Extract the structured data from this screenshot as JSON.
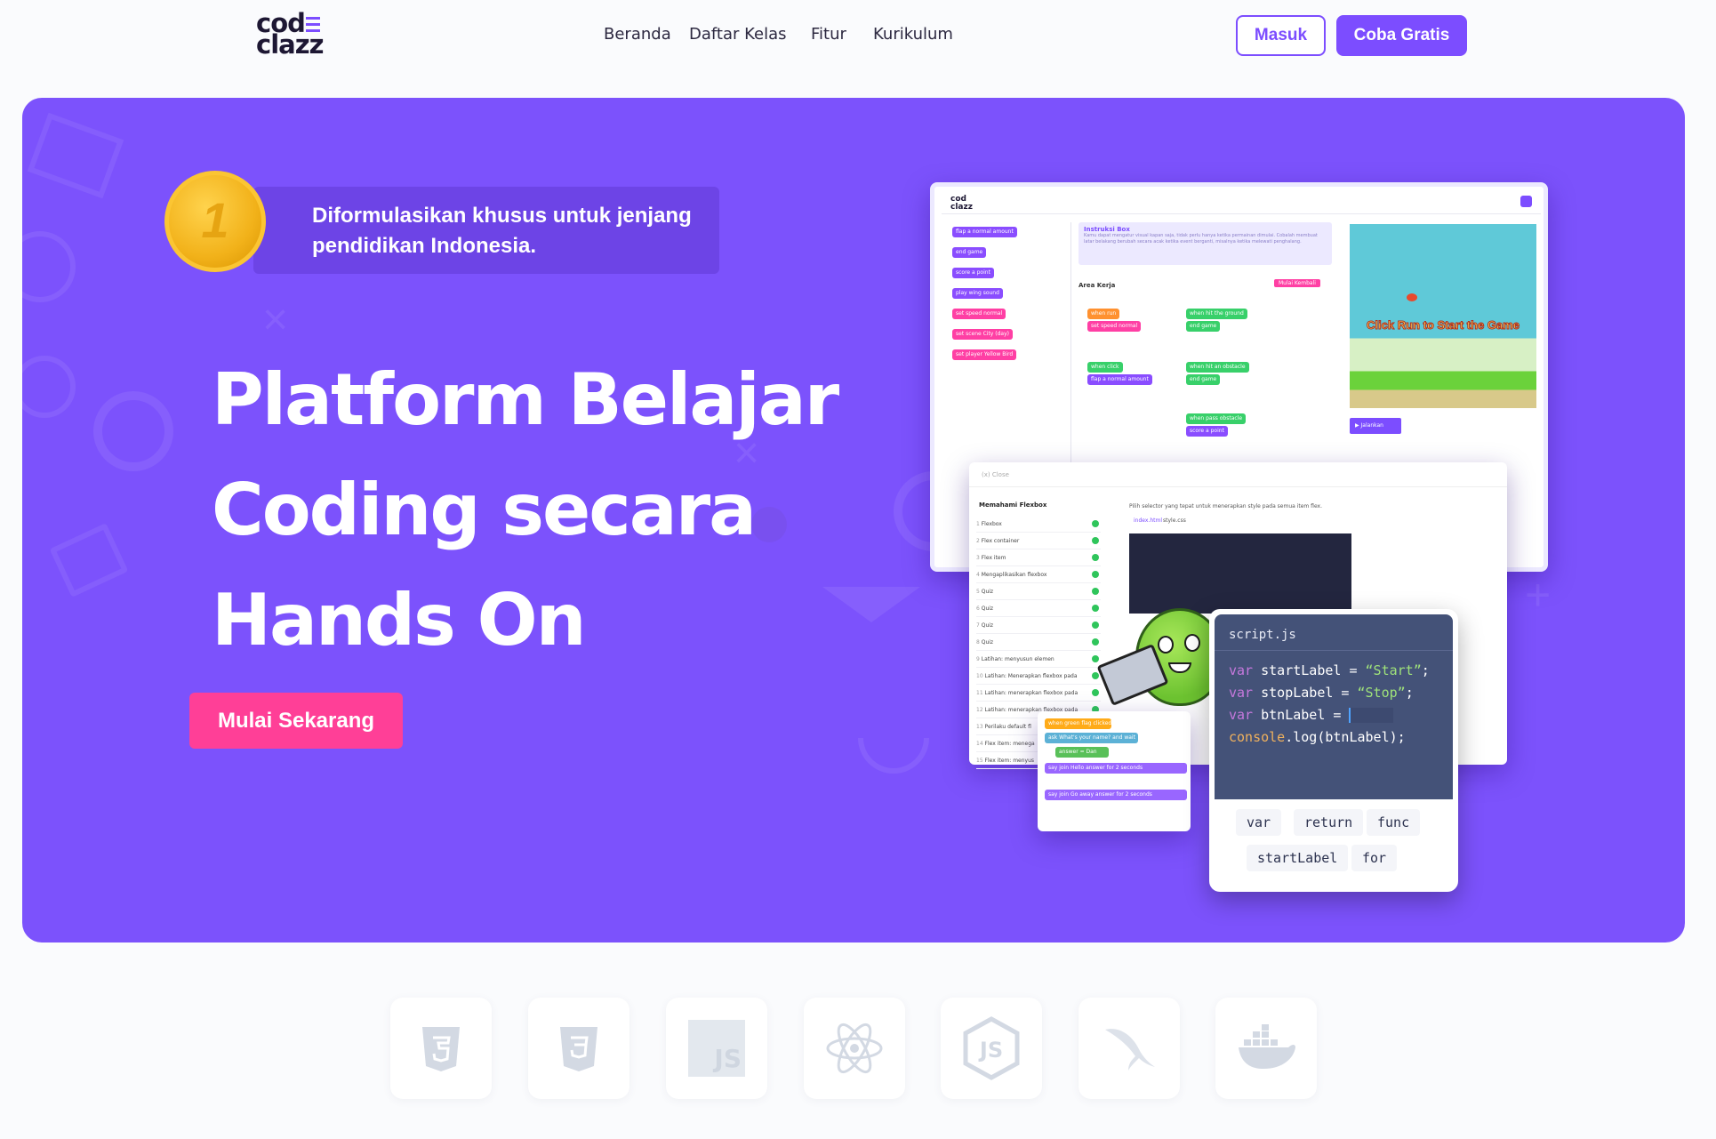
{
  "header": {
    "logo_top": "cod",
    "logo_bottom": "clazz",
    "nav": [
      "Beranda",
      "Daftar Kelas",
      "Fitur",
      "Kurikulum"
    ],
    "login_label": "Masuk",
    "trial_label": "Coba Gratis"
  },
  "hero": {
    "badge_text": "Diformulasikan khusus untuk jenjang pendidikan Indonesia.",
    "medal_number": "1",
    "title_lines": [
      "Platform Belajar",
      "Coding secara",
      "Hands On"
    ],
    "cta_label": "Mulai Sekarang"
  },
  "mock_editor": {
    "logo": "cod clazz",
    "instructions_title": "Instruksi Box",
    "instructions_text": "Kamu dapat mengatur visual kapan saja, tidak perlu hanya ketika permainan dimulai. Cobalah membuat latar belakang berubah secara acak ketika event berganti, misalnya ketika melewati penghalang.",
    "work_area": "Area Kerja",
    "reset_label": "Mulai Kembali",
    "palette_blocks": [
      "flap a normal amount",
      "end game",
      "score a point",
      "play wing sound",
      "set speed normal",
      "set scene City (day)",
      "set player Yellow Bird"
    ],
    "workspace_blocks": [
      "when run",
      "set speed normal",
      "when hit the ground",
      "end game",
      "when click",
      "flap a normal amount",
      "when hit an obstacle",
      "end game",
      "when pass obstacle",
      "score a point"
    ],
    "game_text": "Click Run to Start the Game",
    "run_label": "Jalankan"
  },
  "mock_lesson": {
    "close_label": "Close",
    "lesson_title": "Memahami Flexbox",
    "lesson_items": [
      "Flexbox",
      "Flex container",
      "Flex item",
      "Mengaplikasikan flexbox",
      "Quiz",
      "Quiz",
      "Quiz",
      "Quiz",
      "Latihan: menyusun elemen",
      "Latihan: Menerapkan flexbox pada",
      "Latihan: menerapkan flexbox pada",
      "Latihan: menerapkan flexbox pada",
      "Perilaku default fl",
      "Flex item: menega",
      "Flex item: menyus"
    ],
    "prompt": "Pilih selector yang tepat untuk menerapkan style pada semua item flex.",
    "tabs": [
      "index.html",
      "style.css"
    ]
  },
  "mock_scratch": {
    "blocks": [
      "when green flag clicked",
      "ask What's your name? and wait",
      "answer = Dan",
      "say join Hello answer for 2 seconds",
      "say join Go away answer for 2 seconds"
    ]
  },
  "code_card": {
    "filename": "script.js",
    "lines": [
      {
        "kw": "var",
        "rest": " startLabel = ",
        "str": "“Start”",
        "end": ";"
      },
      {
        "kw": "var",
        "rest": " stopLabel = ",
        "str": "“Stop”",
        "end": ";"
      },
      {
        "kw": "var",
        "rest": " btnLabel = ",
        "str": "",
        "end": ""
      },
      {
        "kw": "",
        "rest": "",
        "fn": "console",
        "str": "",
        "end": ".log(btnLabel);"
      }
    ],
    "chips": [
      "var",
      "return",
      "func",
      "startLabel",
      "for"
    ]
  },
  "tech_icons": [
    "html5-icon",
    "css3-icon",
    "javascript-icon",
    "react-icon",
    "nodejs-icon",
    "mysql-icon",
    "docker-icon"
  ],
  "colors": {
    "primary": "#7c4dff",
    "hero_bg": "#7c52fc",
    "cta": "#ff3f97",
    "code_bg": "#445278"
  }
}
